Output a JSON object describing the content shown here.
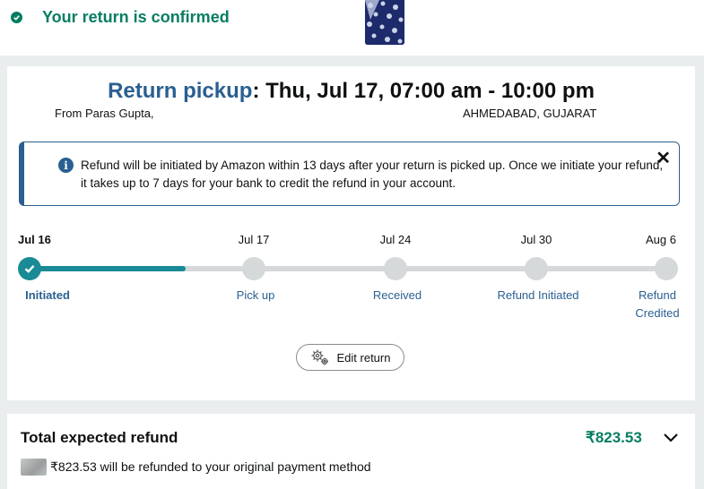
{
  "header": {
    "confirmed_text": "Your return is confirmed"
  },
  "pickup": {
    "label": "Return pickup",
    "schedule": ": Thu, Jul 17, 07:00 am - 10:00 pm",
    "from": "From Paras Gupta,",
    "city": "AHMEDABAD, GUJARAT"
  },
  "info": {
    "text": "Refund will be initiated by Amazon within 13 days after your return is picked up. Once we initiate your refund, it takes up to 7 days for your bank to credit the refund in your account.",
    "close": "✕"
  },
  "timeline": {
    "progress": 0.24,
    "steps": [
      {
        "date": "Jul 16",
        "label": "Initiated",
        "done": true
      },
      {
        "date": "Jul 17",
        "label": "Pick up",
        "done": false
      },
      {
        "date": "Jul 24",
        "label": "Received",
        "done": false
      },
      {
        "date": "Jul 30",
        "label": "Refund Initiated",
        "done": false
      },
      {
        "date": "Aug 6",
        "label": "Refund Credited",
        "done": false
      }
    ]
  },
  "edit_button": {
    "label": "Edit return",
    "icon": "gear-icon"
  },
  "refund": {
    "title": "Total expected refund",
    "amount": "₹823.53",
    "line": "₹823.53 will be refunded to your original payment method"
  },
  "colors": {
    "accent_green": "#067d62",
    "link_blue": "#2a5f91",
    "progress_teal": "#1a8a96"
  }
}
